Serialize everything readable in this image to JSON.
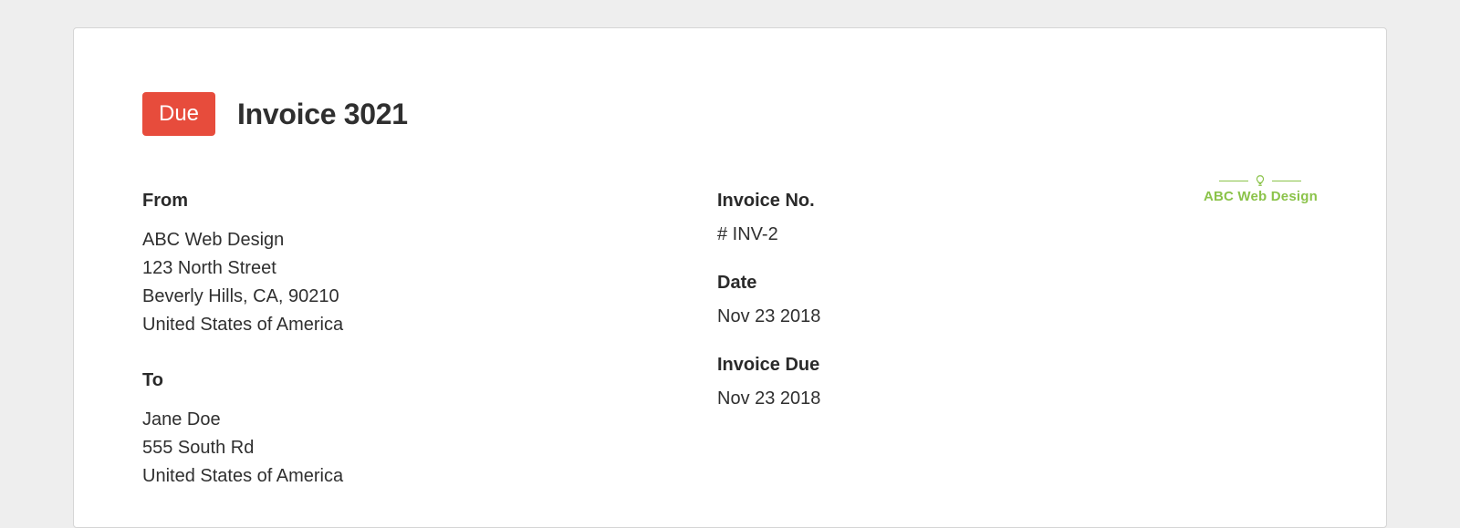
{
  "header": {
    "status_label": "Due",
    "title": "Invoice 3021"
  },
  "from": {
    "label": "From",
    "name": "ABC Web Design",
    "street": "123 North Street",
    "city_line": "Beverly Hills, CA, 90210",
    "country": "United States of America"
  },
  "to": {
    "label": "To",
    "name": "Jane Doe",
    "street": "555 South Rd",
    "country": "United States of America"
  },
  "meta": {
    "number_label": "Invoice No.",
    "number_value": "# INV-2",
    "date_label": "Date",
    "date_value": "Nov 23 2018",
    "due_label": "Invoice Due",
    "due_value": "Nov 23 2018"
  },
  "logo": {
    "text": "ABC Web Design"
  }
}
